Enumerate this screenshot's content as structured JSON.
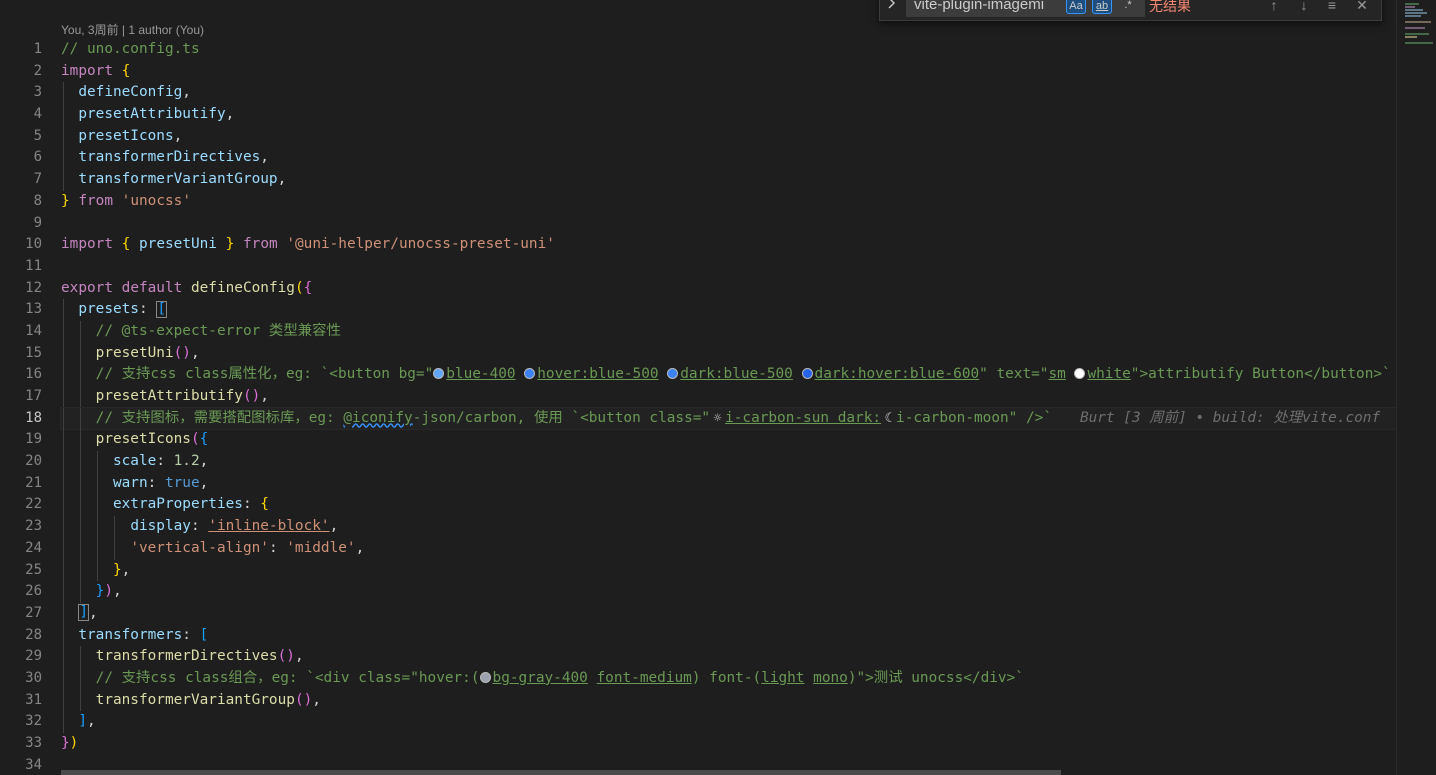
{
  "codelens": "You, 3周前 | 1 author (You)",
  "find_widget": {
    "toggle_icon": "chevron-right-icon",
    "query": "vite-plugin-imagemi",
    "opt_case": "Aa",
    "opt_word": "ab",
    "opt_regex": ".*",
    "status": "无结果",
    "btn_prev": "↑",
    "btn_next": "↓",
    "btn_selection": "≡",
    "btn_close": "✕"
  },
  "active_line": 18,
  "line_numbers": [
    "1",
    "2",
    "3",
    "4",
    "5",
    "6",
    "7",
    "8",
    "9",
    "10",
    "11",
    "12",
    "13",
    "14",
    "15",
    "16",
    "17",
    "18",
    "19",
    "20",
    "21",
    "22",
    "23",
    "24",
    "25",
    "26",
    "27",
    "28",
    "29",
    "30",
    "31",
    "32",
    "33",
    "34"
  ],
  "code": {
    "l1": "// uno.config.ts",
    "l2_kw": "import",
    "l2_b": " {",
    "l3": "defineConfig",
    "l4": "presetAttributify",
    "l5": "presetIcons",
    "l6": "transformerDirectives",
    "l7": "transformerVariantGroup",
    "l8_from": "from",
    "l8_str": "'unocss'",
    "l10_kw": "import",
    "l10_id": "presetUni",
    "l10_from": "from",
    "l10_str": "'@uni-helper/unocss-preset-uni'",
    "l12_kw1": "export",
    "l12_kw2": "default",
    "l12_fn": "defineConfig",
    "l13": "presets",
    "l14": "// @ts-expect-error 类型兼容性",
    "l15": "presetUni",
    "l16_a": "// 支持css class属性化，eg: `<button bg=\"",
    "l16_c1": "blue-400",
    "l16_c2": "hover:blue-500",
    "l16_c3": "dark:blue-500",
    "l16_c4": "dark:hover:blue-600",
    "l16_b": "\" text=\"",
    "l16_sm": "sm",
    "l16_white": "white",
    "l16_c": "\">attributify Button</button>`",
    "l17": "presetAttributify",
    "l18_a": "// 支持图标，需要搭配图标库，eg: ",
    "l18_link": "@iconify",
    "l18_b": "-json/carbon, 使用 `<button class=\"",
    "l18_sun": "☼",
    "l18_c": "i-carbon-sun dark:",
    "l18_moon": "☾",
    "l18_d": "i-carbon-moon\" />`",
    "l18_blame": "Burt [3 周前] • build: 处理vite.conf",
    "l19": "presetIcons",
    "l20_k": "scale",
    "l20_v": "1.2",
    "l21_k": "warn",
    "l21_v": "true",
    "l22_k": "extraProperties",
    "l23_k": "display",
    "l23_v": "'inline-block'",
    "l24_k": "'vertical-align'",
    "l24_v": "'middle'",
    "l28": "transformers",
    "l29": "transformerDirectives",
    "l30_a": "// 支持css class组合，eg: `<div class=\"hover:",
    "l30_g": "bg-gray-400",
    "l30_fm": "font-medium",
    "l30_b": " font-",
    "l30_light": "light",
    "l30_mono": "mono",
    "l30_c": "\">测试 unocss</div>`",
    "l31": "transformerVariantGroup"
  },
  "colors": {
    "blue_400": "#60a5fa",
    "blue_500": "#3b82f6",
    "blue_600": "#2563eb",
    "white": "#ffffff",
    "gray_400": "#9ca3af"
  }
}
